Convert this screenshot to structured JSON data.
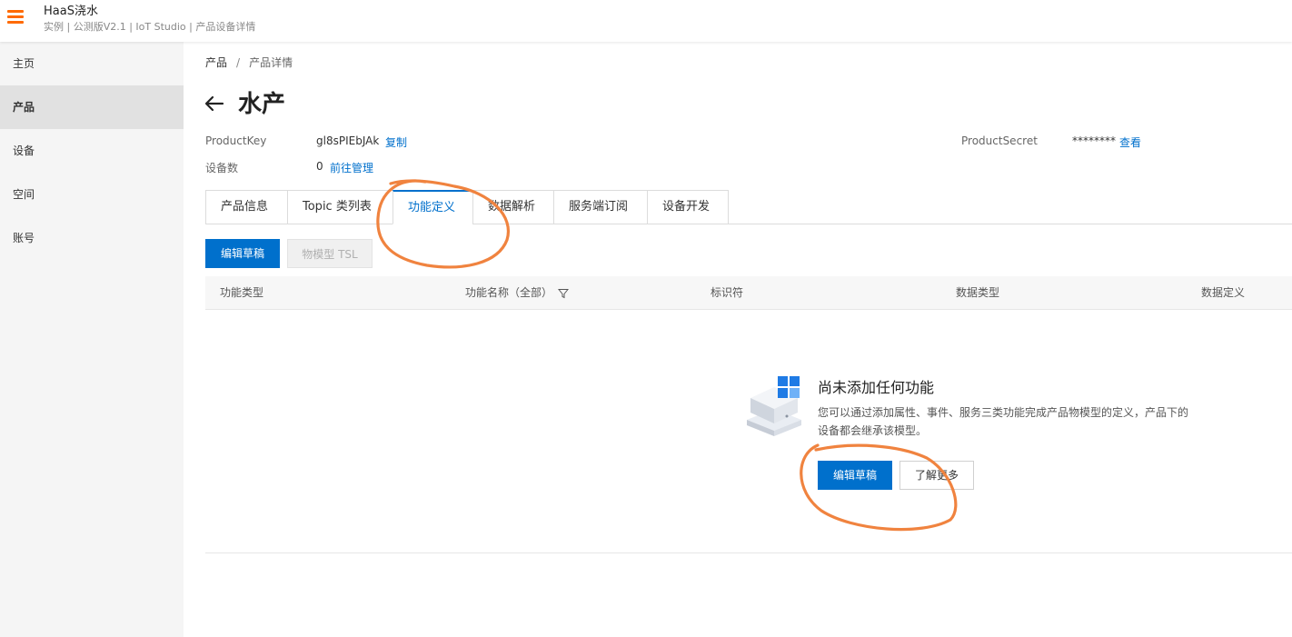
{
  "header": {
    "app_title": "HaaS浇水",
    "subtitle": "实例 | 公测版V2.1 | IoT Studio | 产品设备详情"
  },
  "sidebar": {
    "items": [
      {
        "label": "主页",
        "active": false
      },
      {
        "label": "产品",
        "active": true
      },
      {
        "label": "设备",
        "active": false
      },
      {
        "label": "空间",
        "active": false
      },
      {
        "label": "账号",
        "active": false
      }
    ]
  },
  "breadcrumb": {
    "root": "产品",
    "separator": "/",
    "current": "产品详情"
  },
  "product": {
    "name": "水产",
    "product_key_label": "ProductKey",
    "product_key_value": "gl8sPIEbJAk",
    "copy_label": "复制",
    "product_secret_label": "ProductSecret",
    "product_secret_value": "********",
    "view_label": "查看",
    "device_count_label": "设备数",
    "device_count_value": "0",
    "manage_label": "前往管理"
  },
  "tabs": [
    {
      "label": "产品信息",
      "active": false
    },
    {
      "label": "Topic 类列表",
      "active": false
    },
    {
      "label": "功能定义",
      "active": true
    },
    {
      "label": "数据解析",
      "active": false
    },
    {
      "label": "服务端订阅",
      "active": false
    },
    {
      "label": "设备开发",
      "active": false
    }
  ],
  "toolbar": {
    "edit_draft_label": "编辑草稿",
    "tsl_label": "物模型 TSL"
  },
  "table": {
    "columns": [
      "功能类型",
      "功能名称（全部）",
      "标识符",
      "数据类型",
      "数据定义"
    ]
  },
  "empty_state": {
    "title": "尚未添加任何功能",
    "description": "您可以通过添加属性、事件、服务三类功能完成产品物模型的定义，产品下的设备都会继承该模型。",
    "edit_draft_label": "编辑草稿",
    "learn_more_label": "了解更多"
  },
  "colors": {
    "accent": "#0070cc",
    "brand": "#ff6a00",
    "annotation": "#f0833f",
    "sidebar_bg": "#f5f5f5",
    "sidebar_active_bg": "#e1e1e1"
  }
}
